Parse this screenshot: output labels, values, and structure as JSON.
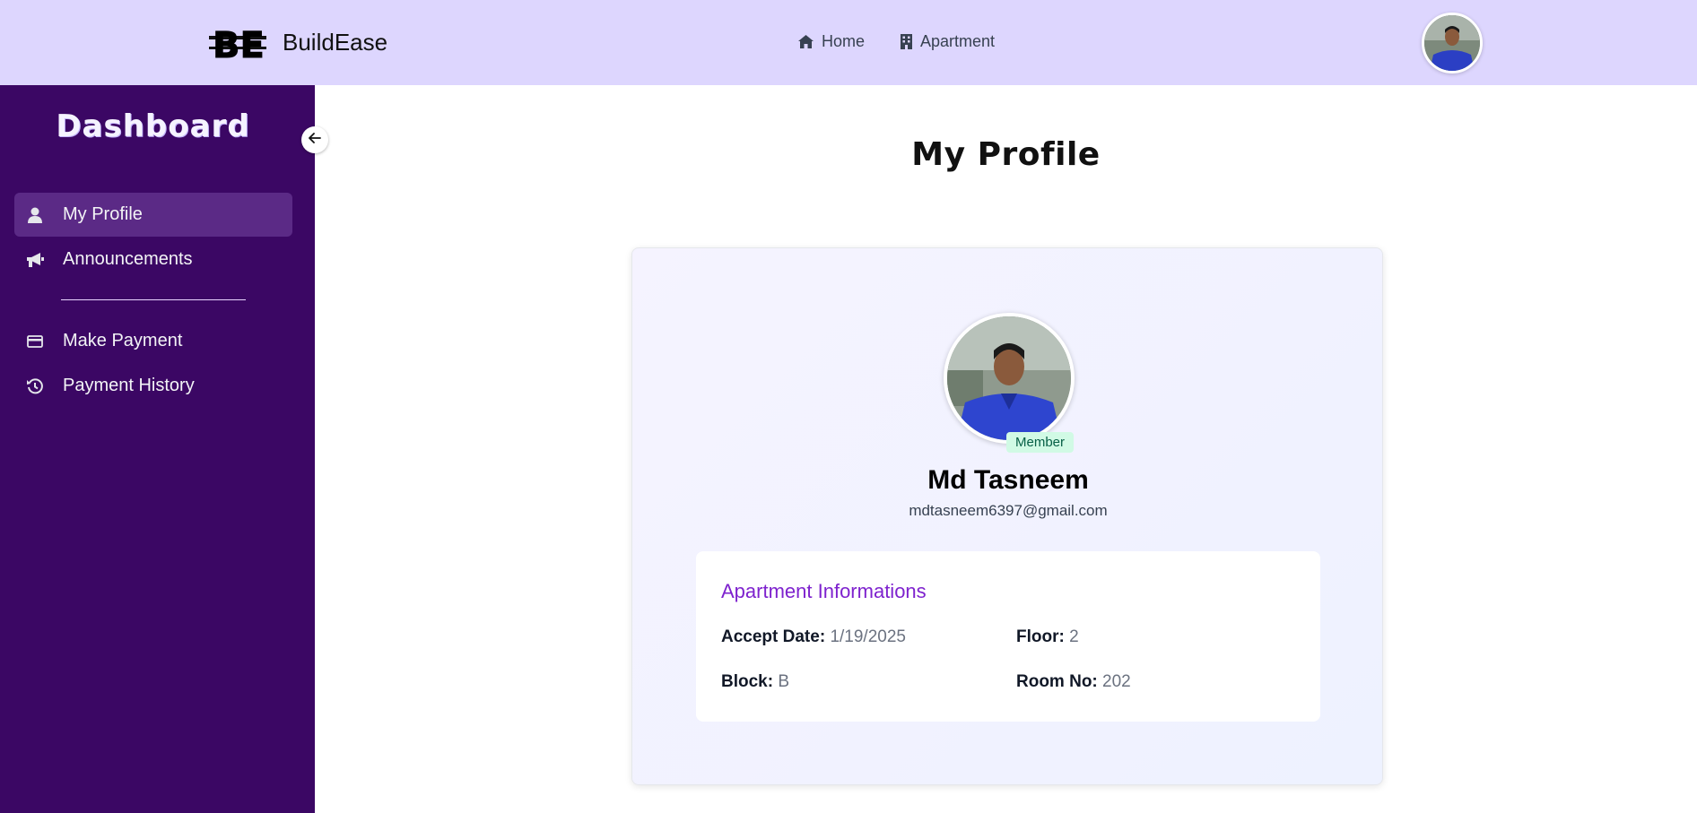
{
  "navbar": {
    "brand_name": "BuildEase",
    "logo_text": "BE",
    "links": [
      {
        "label": "Home",
        "icon": "home-icon"
      },
      {
        "label": "Apartment",
        "icon": "building-icon"
      }
    ]
  },
  "sidebar": {
    "title": "Dashboard",
    "items": [
      {
        "label": "My Profile",
        "icon": "user-icon",
        "active": true
      },
      {
        "label": "Announcements",
        "icon": "megaphone-icon",
        "active": false
      },
      {
        "label": "Make Payment",
        "icon": "credit-card-icon",
        "active": false
      },
      {
        "label": "Payment History",
        "icon": "history-icon",
        "active": false
      }
    ]
  },
  "main": {
    "title": "My Profile",
    "profile": {
      "role": "Member",
      "name": "Md Tasneem",
      "email": "mdtasneem6397@gmail.com"
    },
    "apartment": {
      "heading": "Apartment Informations",
      "accept_date_label": "Accept Date:",
      "accept_date": "1/19/2025",
      "floor_label": "Floor:",
      "floor": "2",
      "block_label": "Block:",
      "block": "B",
      "room_label": "Room No:",
      "room": "202"
    }
  },
  "colors": {
    "navbar_bg": "#ddd6fe",
    "sidebar_bg": "#3b0764",
    "accent": "#7e22ce",
    "badge_bg": "#d1fae5"
  }
}
